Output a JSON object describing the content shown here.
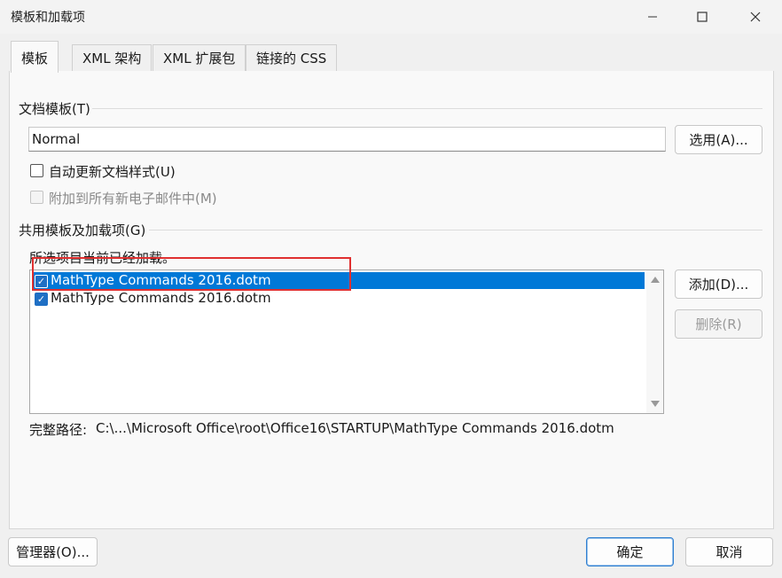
{
  "window": {
    "title": "模板和加载项",
    "minimize_icon": "minimize-icon",
    "maximize_icon": "maximize-icon",
    "close_icon": "close-icon"
  },
  "tabs": [
    {
      "label": "模板",
      "active": true
    },
    {
      "label": "XML 架构",
      "active": false
    },
    {
      "label": "XML 扩展包",
      "active": false
    },
    {
      "label": "链接的 CSS",
      "active": false
    }
  ],
  "document_template": {
    "group_label": "文档模板(T)",
    "value": "Normal",
    "choose_button": "选用(A)...",
    "auto_update_label": "自动更新文档样式(U)",
    "auto_update_checked": false,
    "attach_all_label": "附加到所有新电子邮件中(M)",
    "attach_all_checked": false,
    "attach_all_disabled": true
  },
  "global_templates": {
    "group_label": "共用模板及加载项(G)",
    "caption": "所选项目当前已经加载。",
    "items": [
      {
        "label": "MathType Commands 2016.dotm",
        "checked": true,
        "selected": true
      },
      {
        "label": "MathType Commands 2016.dotm",
        "checked": true,
        "selected": false
      }
    ],
    "add_button": "添加(D)...",
    "remove_button": "删除(R)",
    "full_path_label": "完整路径:",
    "full_path_value": "C:\\...\\Microsoft Office\\root\\Office16\\STARTUP\\MathType Commands 2016.dotm"
  },
  "footer": {
    "organizer_button": "管理器(O)...",
    "ok_button": "确定",
    "cancel_button": "取消"
  },
  "colors": {
    "selection": "#0078d7",
    "highlight_box": "#e03030"
  }
}
